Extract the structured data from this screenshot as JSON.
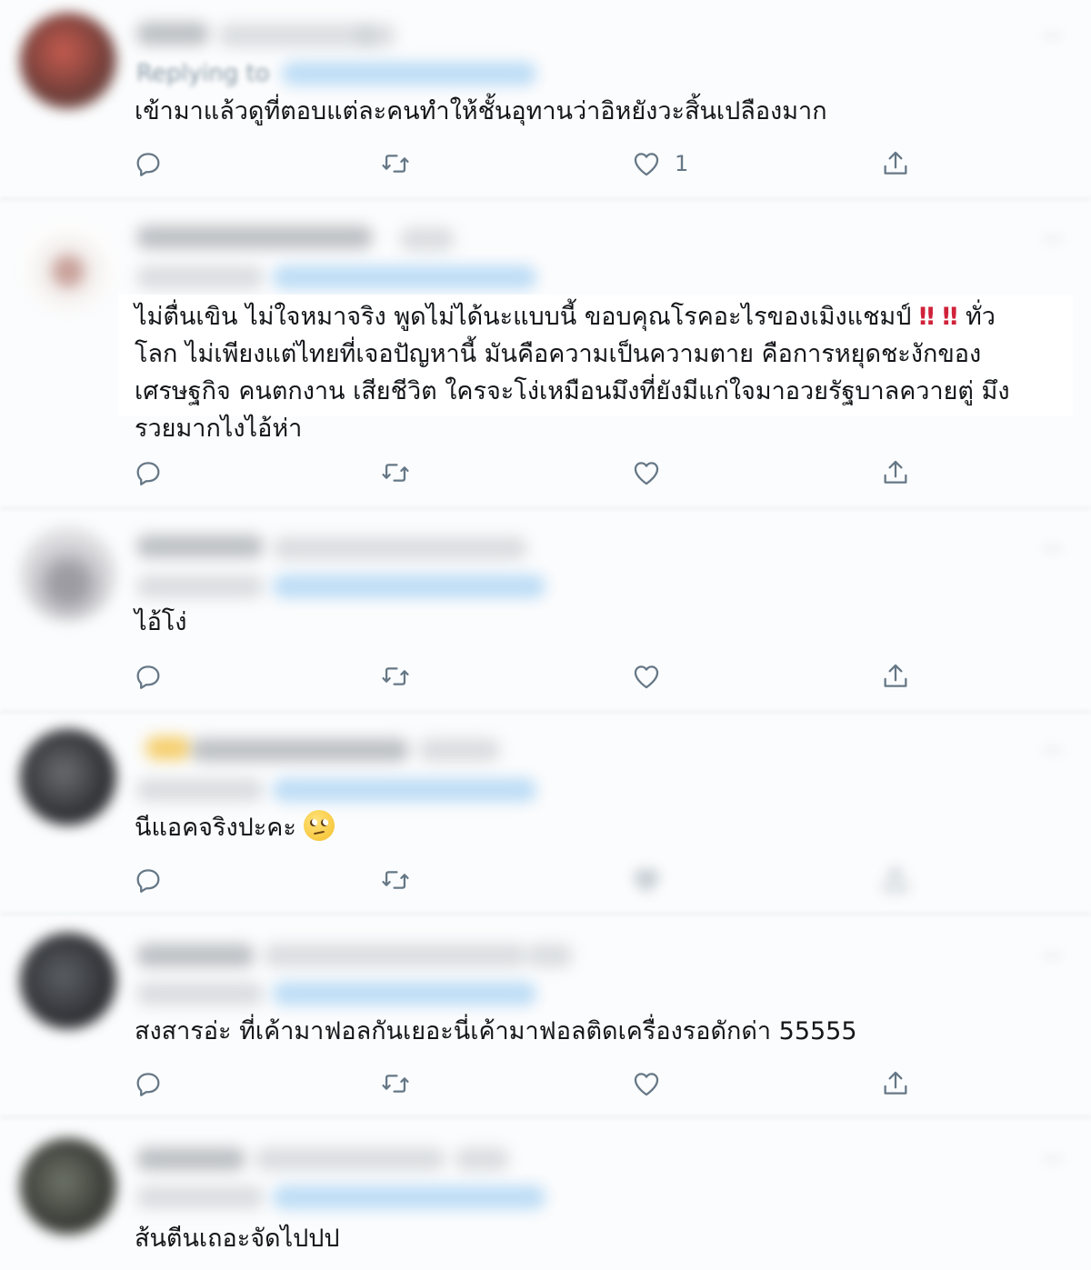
{
  "tweets": [
    {
      "text": "เข้ามาแล้วดูที่ตอบแต่ละคนทำให้ชั้นอุทานว่าอิหยังวะสิ้นเปลืองมาก",
      "replying_prefix": "Replying to",
      "avatar_color": "#7a4a44",
      "like_count": "1"
    },
    {
      "text_parts": [
        "ไม่ตื่นเขิน ไม่ใจหมาจริง พูดไม่ได้นะแบบนี้ ขอบคุณโรคอะไรของเมิงแชมป์ ",
        "‼",
        " ",
        "‼",
        " ทั่ว\nโลก ไม่เพียงแต่ไทยที่เจอปัญหานี้ มันคือความเป็นความตาย คือการหยุดชะงักของ\nเศรษฐกิจ คนตกงาน เสียชีวิต ใครจะโง่เหมือนมึงที่ยังมีแก่ใจมาอวยรัฐบาลควายตู่ มึง\nรวยมากไงไอ้ห่า"
      ],
      "avatar_color": "#e9e4e2"
    },
    {
      "text": "ไอ้โง่",
      "avatar_color": "#b9b9bd"
    },
    {
      "text": "นีแอคจริงปะคะ",
      "emoji": "face-with-rolling-eyes-emoji",
      "avatar_color": "#45474b"
    },
    {
      "text": "สงสารอ่ะ ที่เค้ามาฟอลกันเยอะนี่เค้ามาฟอลติดเครื่องรอดักด่า 55555",
      "avatar_color": "#3b3e42"
    },
    {
      "text": "ส้นตีนเถอะจัดไปปป",
      "avatar_color": "#4a4f47"
    }
  ],
  "icons": {
    "reply": "reply-icon",
    "retweet": "retweet-icon",
    "like": "heart-icon",
    "share": "share-icon",
    "more": "more-icon"
  },
  "colors": {
    "icon_gray": "#657786",
    "reply_link_blue": "#1da1f2",
    "text": "#141619",
    "exclamation_red": "#d0223a"
  }
}
